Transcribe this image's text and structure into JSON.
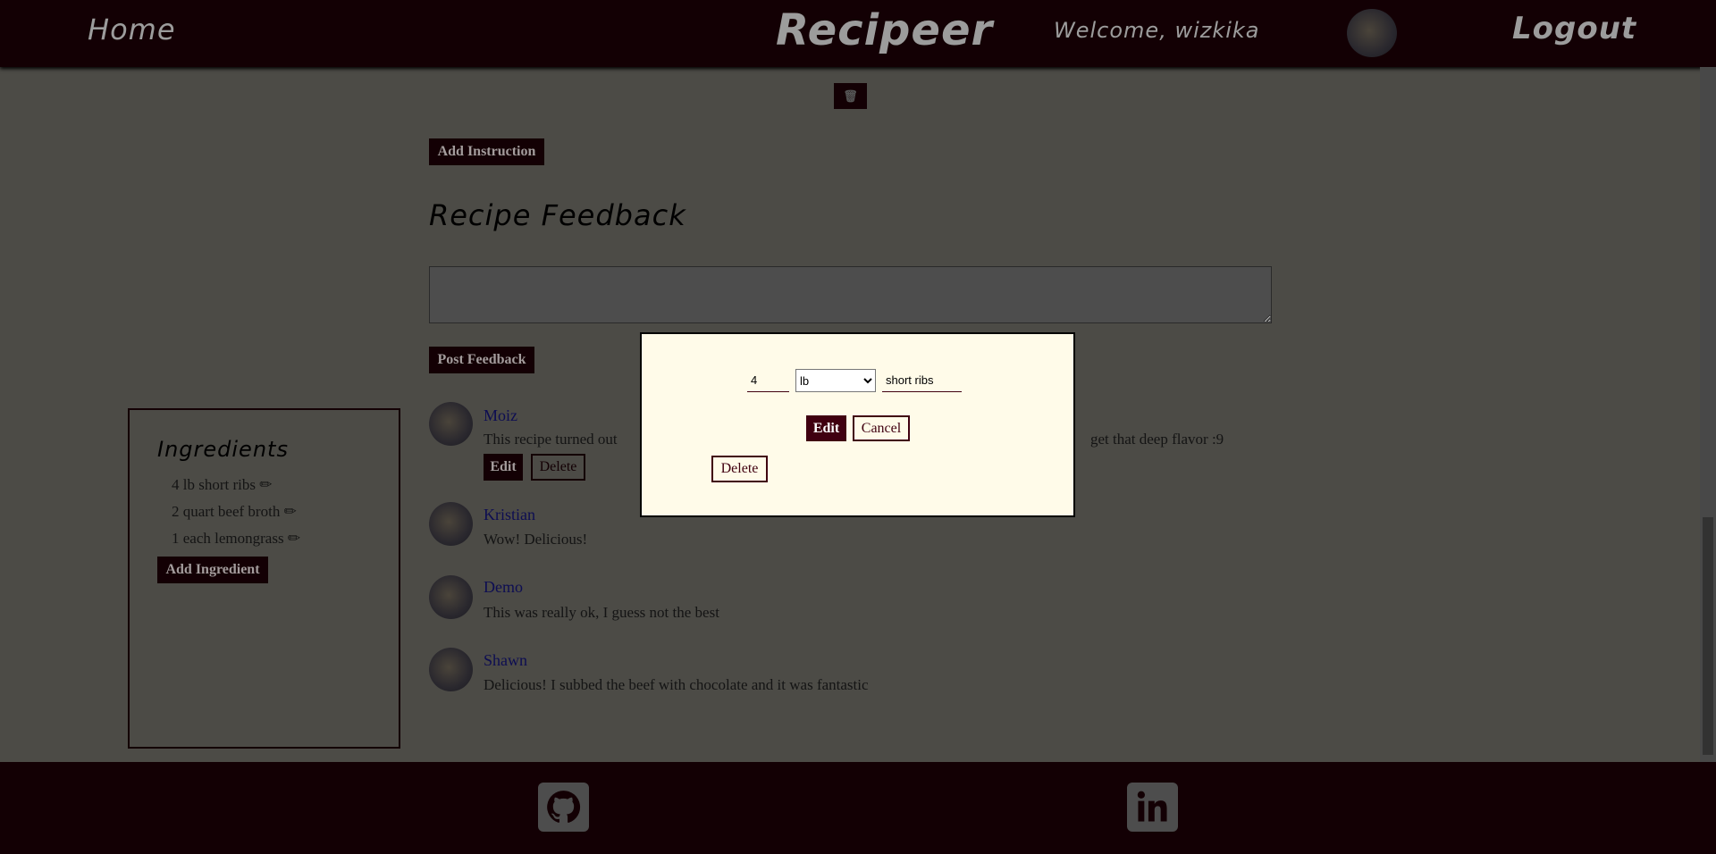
{
  "header": {
    "home": "Home",
    "brand": "Recipeer",
    "welcome": "Welcome, wizkika",
    "logout": "Logout"
  },
  "main": {
    "add_instruction": "Add Instruction",
    "feedback_title": "Recipe Feedback",
    "feedback_placeholder": "",
    "post_feedback": "Post Feedback",
    "comments": [
      {
        "name": "Moiz",
        "text": "This recipe turned out",
        "text_end": "get that deep flavor :9",
        "edit": "Edit",
        "delete": "Delete"
      },
      {
        "name": "Kristian",
        "text": "Wow! Delicious!"
      },
      {
        "name": "Demo",
        "text": "This was really ok, I guess not the best"
      },
      {
        "name": "Shawn",
        "text": "Delicious! I subbed the beef with chocolate and it was fantastic"
      }
    ]
  },
  "ingredients": {
    "title": "Ingredients",
    "items": [
      "4 lb short ribs",
      "2 quart beef broth",
      "1 each lemongrass"
    ],
    "add": "Add Ingredient"
  },
  "modal": {
    "quantity": "4",
    "unit": "lb",
    "ingredient": "short ribs",
    "edit": "Edit",
    "cancel": "Cancel",
    "delete": "Delete"
  },
  "footer": {
    "icons": [
      "github-icon",
      "linkedin-icon"
    ]
  },
  "colors": {
    "brand": "#400010",
    "background": "#fffbe9",
    "link": "#1a1aa0"
  }
}
